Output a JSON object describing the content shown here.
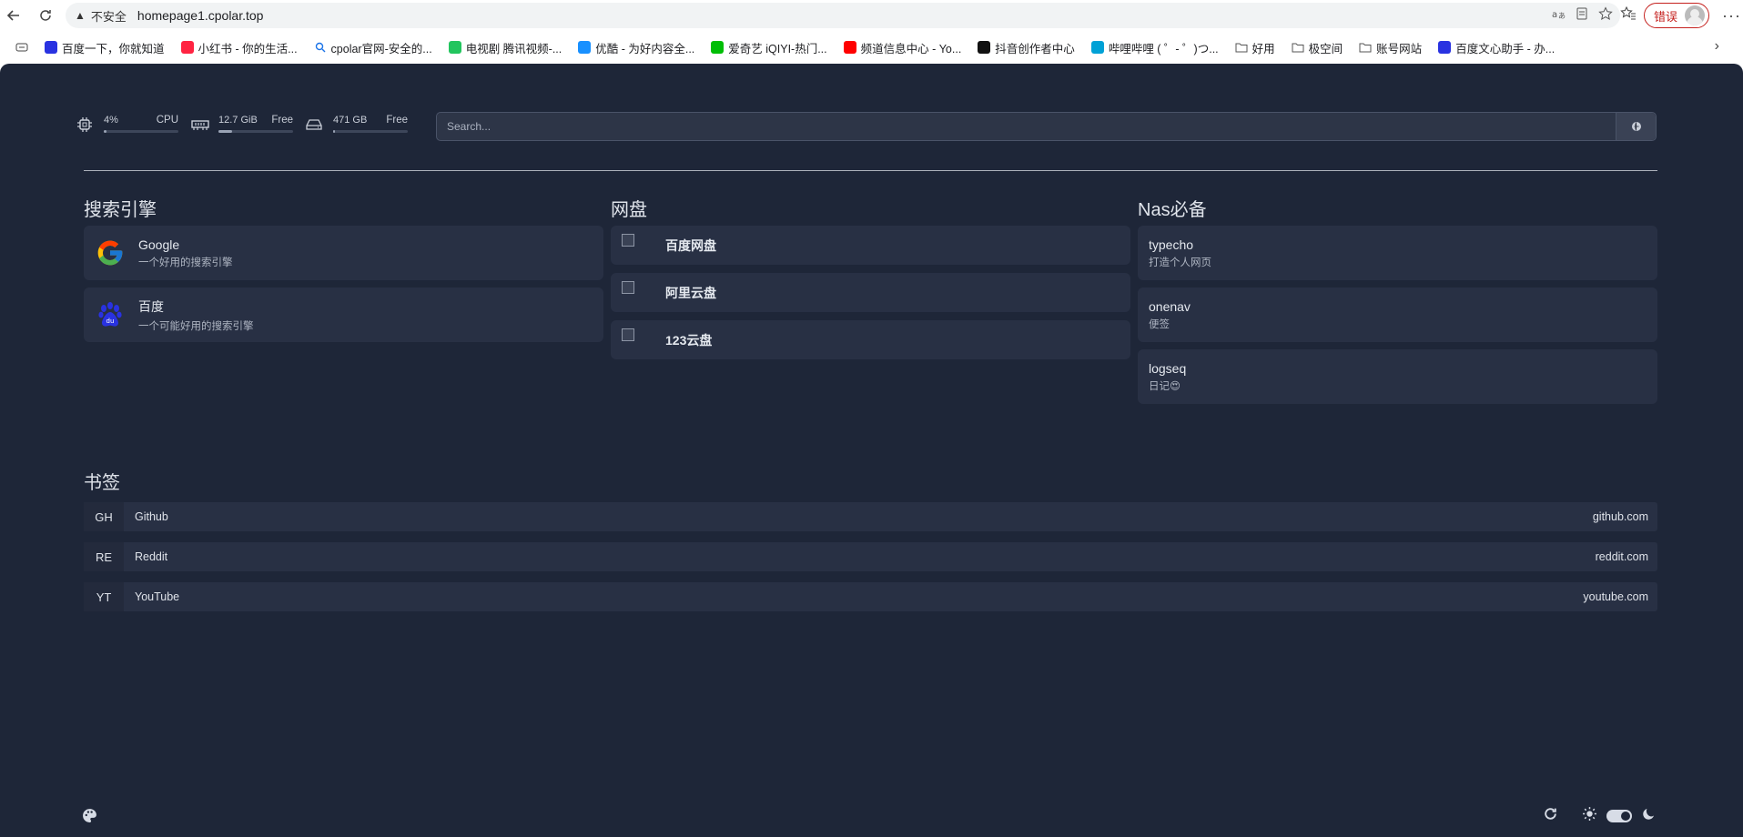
{
  "browser": {
    "insecure_label": "不安全",
    "url": "homepage1.cpolar.top",
    "error_label": "错误",
    "bookmarks": [
      {
        "label": "百度一下，你就知道",
        "icon": "baidu-icon",
        "color": "#2932e1"
      },
      {
        "label": "小红书 - 你的生活...",
        "icon": "xiaohongshu-icon",
        "color": "#ff2442"
      },
      {
        "label": "cpolar官网-安全的...",
        "icon": "search-icon",
        "color": "#1a73e8"
      },
      {
        "label": "电视剧 腾讯视频-...",
        "icon": "tencent-video-icon",
        "color": "#22c55e"
      },
      {
        "label": "优酷 - 为好内容全...",
        "icon": "youku-icon",
        "color": "#1890ff"
      },
      {
        "label": "爱奇艺 iQIYI-热门...",
        "icon": "iqiyi-icon",
        "color": "#00be06"
      },
      {
        "label": "频道信息中心 - Yo...",
        "icon": "youtube-icon",
        "color": "#ff0000"
      },
      {
        "label": "抖音创作者中心",
        "icon": "douyin-icon",
        "color": "#111111"
      },
      {
        "label": "哔哩哔哩 ( ゜- ゜)つ...",
        "icon": "bilibili-icon",
        "color": "#00a1d6"
      },
      {
        "label": "好用",
        "icon": "folder-icon",
        "color": ""
      },
      {
        "label": "极空间",
        "icon": "folder-icon",
        "color": ""
      },
      {
        "label": "账号网站",
        "icon": "folder-icon",
        "color": ""
      },
      {
        "label": "百度文心助手 - 办...",
        "icon": "baidu-icon",
        "color": "#2932e1"
      }
    ]
  },
  "stats": {
    "cpu": {
      "value": "4%",
      "label": "CPU",
      "fraction": 0.04
    },
    "memory": {
      "value": "12.7 GiB",
      "label": "Free",
      "fraction": 0.18
    },
    "disk": {
      "value": "471 GB",
      "label": "Free",
      "fraction": 0.03
    }
  },
  "search": {
    "placeholder": "Search..."
  },
  "groups": [
    {
      "title": "搜索引擎",
      "items": [
        {
          "name": "Google",
          "desc": "一个好用的搜索引擎",
          "icon": "google-icon"
        },
        {
          "name": "百度",
          "desc": "一个可能好用的搜索引擎",
          "icon": "baidu-paw-icon"
        }
      ]
    },
    {
      "title": "网盘",
      "items": [
        {
          "name": "百度网盘"
        },
        {
          "name": "阿里云盘"
        },
        {
          "name": "123云盘"
        }
      ]
    },
    {
      "title": "Nas必备",
      "items": [
        {
          "name": "typecho",
          "desc": "打造个人网页"
        },
        {
          "name": "onenav",
          "desc": "便签"
        },
        {
          "name": "logseq",
          "desc": "日记😍"
        }
      ]
    }
  ],
  "bookmarks_section": {
    "title": "书签",
    "items": [
      {
        "abbr": "GH",
        "name": "Github",
        "host": "github.com"
      },
      {
        "abbr": "RE",
        "name": "Reddit",
        "host": "reddit.com"
      },
      {
        "abbr": "YT",
        "name": "YouTube",
        "host": "youtube.com"
      }
    ]
  },
  "footer": {
    "left_icon": "palette-icon",
    "right_icons": [
      "refresh-icon",
      "sun-icon",
      "theme-toggle",
      "moon-icon"
    ]
  }
}
